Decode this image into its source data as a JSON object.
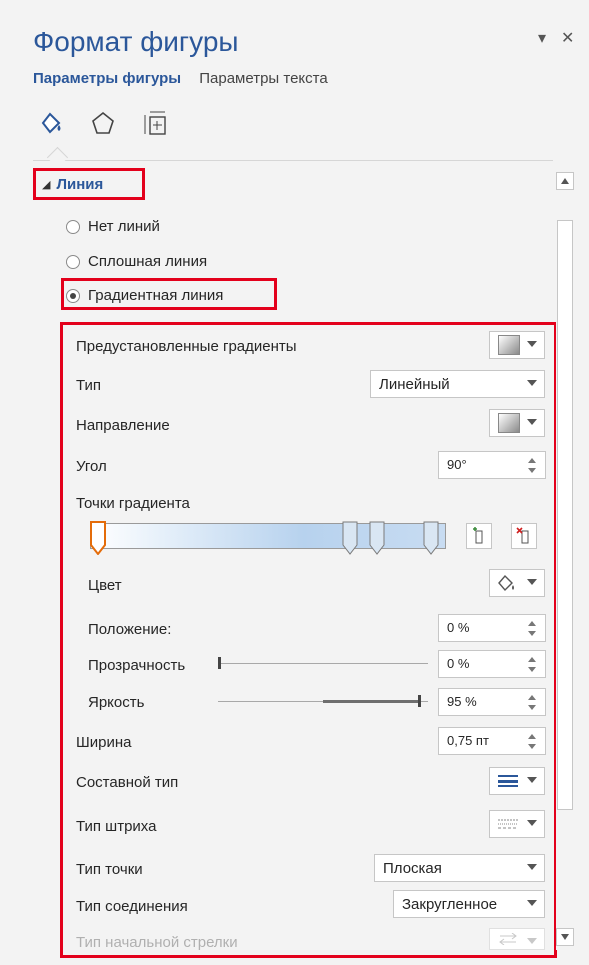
{
  "pane": {
    "title": "Формат фигуры",
    "pin_icon": "▾",
    "close_icon": "✕",
    "tabs": [
      "Параметры фигуры",
      "Параметры текста"
    ],
    "icons": [
      "fill-line-icon",
      "effects-pentagon-icon",
      "size-properties-icon"
    ]
  },
  "section": {
    "title": "Линия",
    "collapse_glyph": "◢"
  },
  "line_options": [
    {
      "label": "Нет линий",
      "selected": false
    },
    {
      "label": "Сплошная линия",
      "selected": false
    },
    {
      "label": "Градиентная линия",
      "selected": true
    }
  ],
  "fields": {
    "preset": {
      "label": "Предустановленные градиенты"
    },
    "type": {
      "label": "Тип",
      "value": "Линейный"
    },
    "direction": {
      "label": "Направление"
    },
    "angle": {
      "label": "Угол",
      "value": "90°"
    },
    "stops": {
      "label": "Точки градиента",
      "stop_positions_pct": [
        0,
        74,
        82,
        98
      ]
    },
    "color": {
      "label": "Цвет"
    },
    "position": {
      "label": "Положение:",
      "value": "0 %"
    },
    "transparency": {
      "label": "Прозрачность",
      "value": "0 %",
      "level_pct": 0
    },
    "brightness": {
      "label": "Яркость",
      "value": "95 %",
      "level_pct": 95
    },
    "width": {
      "label": "Ширина",
      "value": "0,75 пт"
    },
    "compound": {
      "label": "Составной тип"
    },
    "dash": {
      "label": "Тип штриха"
    },
    "cap": {
      "label": "Тип точки",
      "value": "Плоская"
    },
    "join": {
      "label": "Тип соединения",
      "value": "Закругленное"
    },
    "begin_arrow": {
      "label": "Тип начальной стрелки"
    }
  },
  "colors": {
    "accent": "#2b579a",
    "highlight": "#e3001b",
    "pane_bg": "#f3f3f3"
  }
}
